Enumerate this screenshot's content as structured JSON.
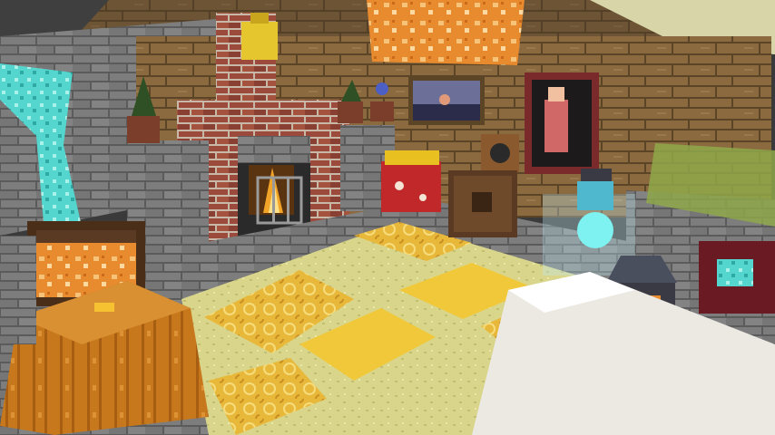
{
  "scene": {
    "type": "minecraft-interior",
    "hud_visible": false,
    "objects": [
      "fireplace",
      "lit-campfire",
      "iron-bars",
      "potted-plants",
      "painting-landscape",
      "painting-portrait",
      "note-block",
      "jukebox",
      "carved-pumpkin",
      "red-mushroom-block",
      "soul-lantern",
      "lantern",
      "ochre-froglight",
      "honeycomb-block-floor",
      "end-stone-floor",
      "quartz-block",
      "sea-lantern-pillar"
    ]
  },
  "colors": {
    "wood_planks": "#8a6a3e",
    "wood_dark": "#5c4426",
    "brick": "#9b4a3c",
    "stone": "#7d7d7d",
    "stone_dark": "#5b5b5b",
    "floor_yellow": "#e8c23a",
    "floor_pale": "#d9d68c",
    "lamp_orange": "#e88a2e",
    "sea_lantern": "#54d6cf",
    "quartz": "#ece8e2",
    "pumpkin": "#c8781c"
  }
}
